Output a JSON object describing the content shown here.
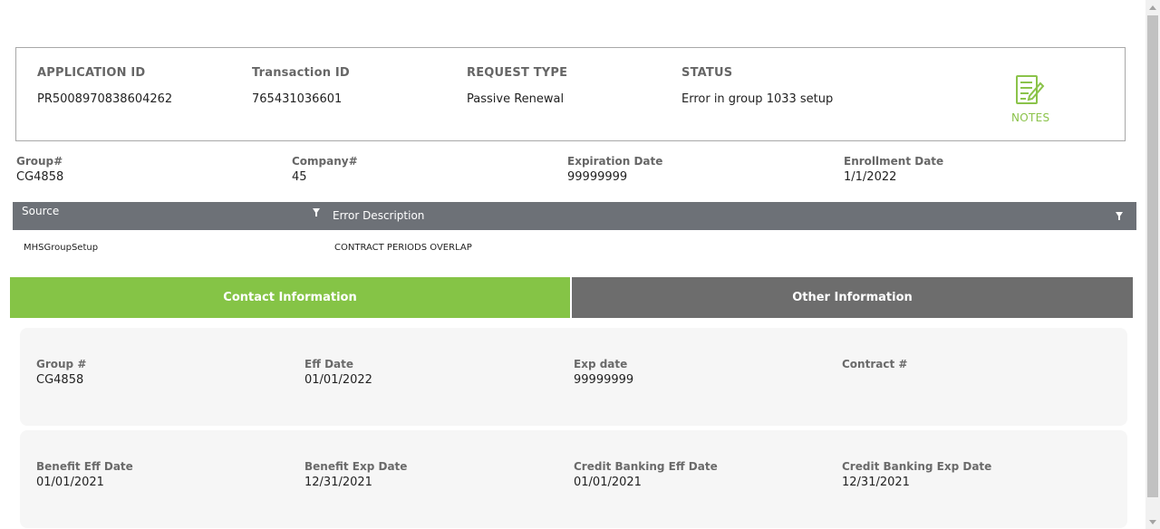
{
  "summary": {
    "application_id_label": "APPLICATION ID",
    "application_id": "PR5008970838604262",
    "transaction_id_label": "Transaction ID",
    "transaction_id": "765431036601",
    "request_type_label": "REQUEST TYPE",
    "request_type": "Passive Renewal",
    "status_label": "STATUS",
    "status": "Error in group 1033 setup",
    "notes_label": "NOTES"
  },
  "group_info": {
    "group_label": "Group#",
    "group": "CG4858",
    "company_label": "Company#",
    "company": "45",
    "expiration_label": "Expiration Date",
    "expiration": "99999999",
    "enrollment_label": "Enrollment Date",
    "enrollment": "1/1/2022"
  },
  "error_grid": {
    "columns": [
      "Source",
      "Error Description"
    ],
    "rows": [
      {
        "source": "MHSGroupSetup",
        "description": "CONTRACT PERIODS OVERLAP"
      }
    ]
  },
  "tabs": [
    {
      "label": "Contact Information",
      "active": true
    },
    {
      "label": "Other Information",
      "active": false
    }
  ],
  "panel1": {
    "group_label": "Group #",
    "group": "CG4858",
    "eff_label": "Eff Date",
    "eff": "01/01/2022",
    "exp_label": "Exp date",
    "exp": "99999999",
    "contract_label": "Contract #",
    "contract": ""
  },
  "panel2": {
    "benefit_eff_label": "Benefit Eff Date",
    "benefit_eff": "01/01/2021",
    "benefit_exp_label": "Benefit Exp Date",
    "benefit_exp": "12/31/2021",
    "credit_eff_label": "Credit Banking Eff Date",
    "credit_eff": "01/01/2021",
    "credit_exp_label": "Credit Banking Exp Date",
    "credit_exp": "12/31/2021"
  },
  "colors": {
    "accent_green": "#85c446",
    "tab_gray": "#6d6d6d",
    "grid_header": "#6d7177"
  },
  "icons": {
    "notes": "notes-document-pencil-icon",
    "filter": "filter-icon"
  }
}
